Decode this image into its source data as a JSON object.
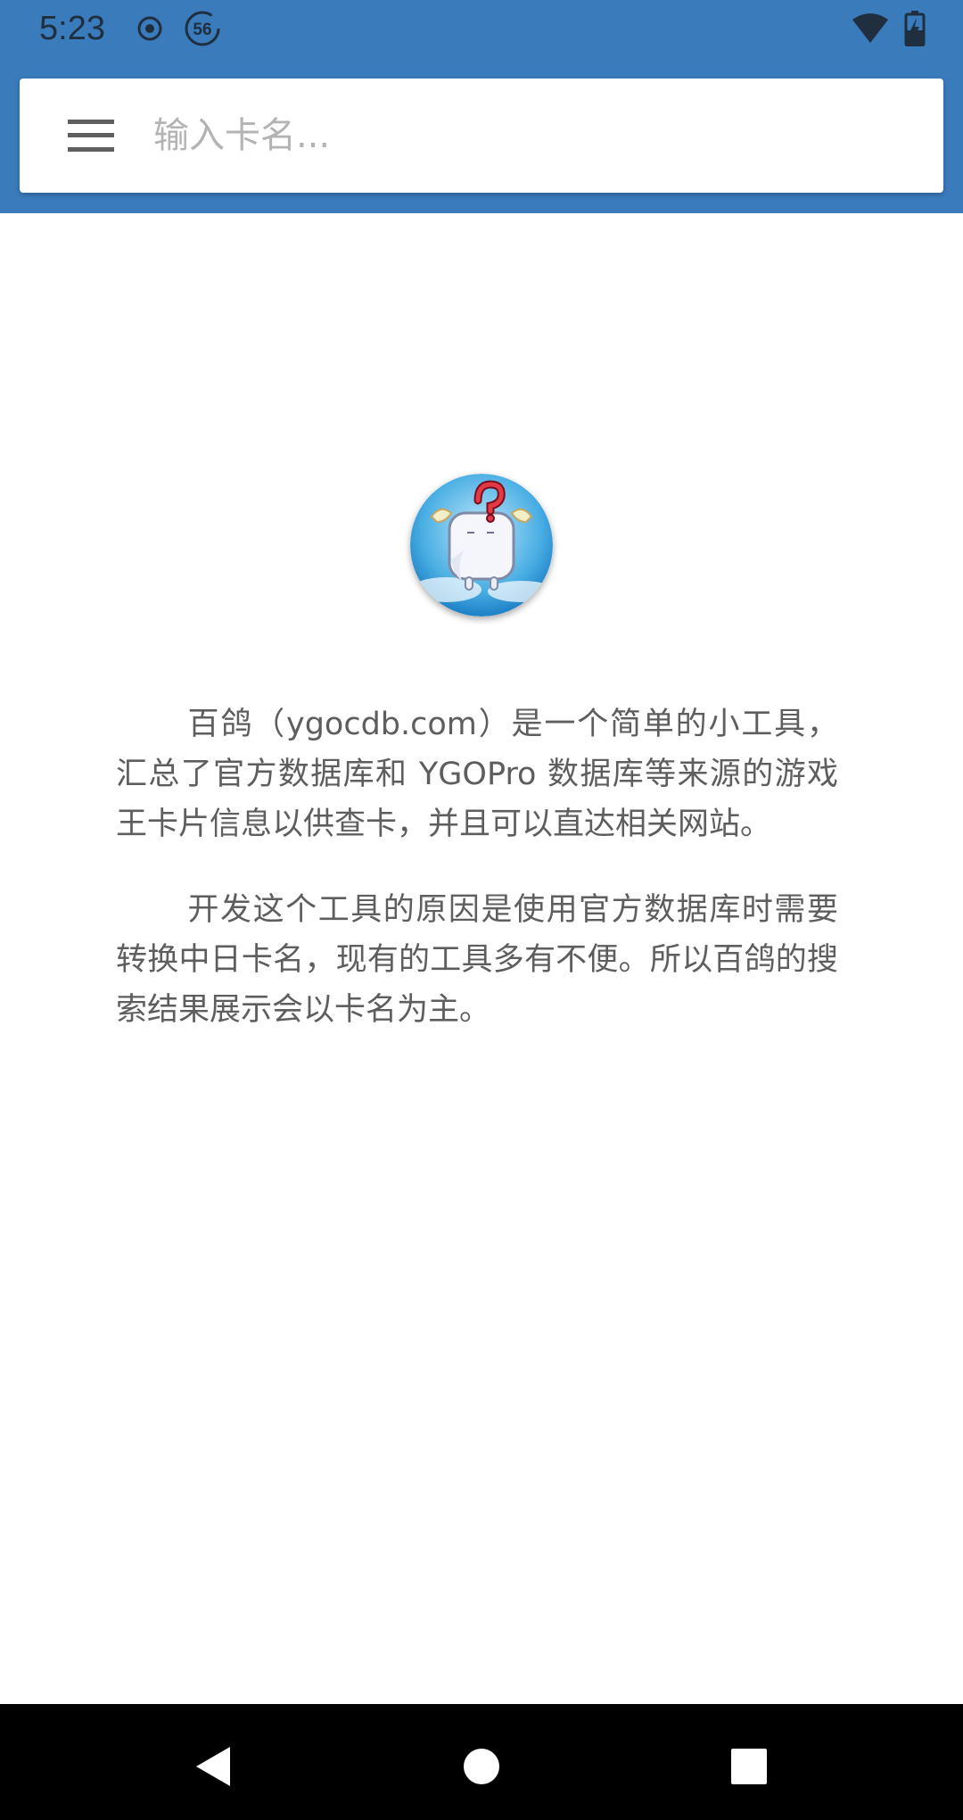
{
  "status_bar": {
    "time": "5:23",
    "badge_number": "56",
    "icons": [
      "record-icon",
      "data-saver-icon",
      "wifi-icon",
      "battery-charging-icon"
    ]
  },
  "search": {
    "placeholder": "输入卡名..."
  },
  "about": {
    "paragraphs": [
      "百鸽（ygocdb.com）是一个简单的小工具，汇总了官方数据库和 YGOPro 数据库等来源的游戏王卡片信息以供查卡，并且可以直达相关网站。",
      "开发这个工具的原因是使用官方数据库时需要转换中日卡名，现有的工具多有不便。所以百鸽的搜索结果展示会以卡名为主。"
    ]
  },
  "colors": {
    "primary": "#3a7bbb",
    "background": "#ffffff",
    "text": "#5e5e5e",
    "nav_bar": "#000000"
  },
  "nav_bar": {
    "icons": [
      "back-icon",
      "home-icon",
      "recents-icon"
    ]
  }
}
